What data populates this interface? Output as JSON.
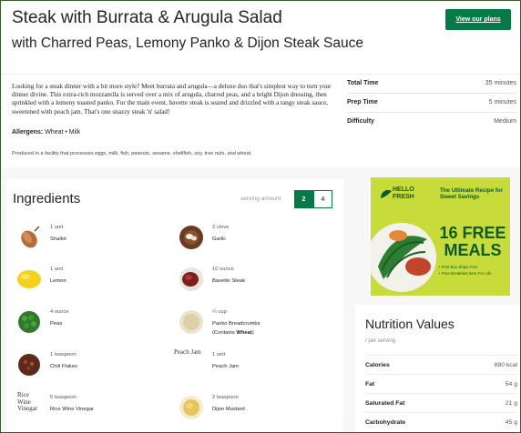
{
  "recipe": {
    "title": "Steak with Burrata & Arugula Salad",
    "subtitle": "with Charred Peas, Lemony Panko & Dijon Steak Sauce",
    "description": "Looking for a steak dinner with a bit more style? Meet burrata and arugula—a deluxe duo that's simplest way to turn your dinner divine. This extra-rich mozzarella is served over a mix of arugula, charred peas, and a bright Dijon dressing, then sprinkled with a lemony toasted panko. For the main event, bavette steak is seared and drizzled with a tangy steak sauce, sweetened with peach jam. That's one snazzy steak 'n' salad!",
    "allergens_label": "Allergens:",
    "allergens_value": "Wheat • Milk",
    "facility_note": "Produced in a facility that processes eggs, milk, fish, peanuts, sesame, shellfish, soy, tree nuts, and wheat."
  },
  "header": {
    "cta_label": "View our plans"
  },
  "meta": [
    {
      "label": "Total Time",
      "value": "35 minutes"
    },
    {
      "label": "Prep Time",
      "value": "5 minutes"
    },
    {
      "label": "Difficulty",
      "value": "Medium"
    }
  ],
  "ingredients": {
    "title": "Ingredients",
    "serving_label": "serving amount",
    "servings": [
      "2",
      "4"
    ],
    "selected_serving": "2",
    "items": [
      {
        "qty": "1 unit",
        "name": "Shallot",
        "icon": "shallot"
      },
      {
        "qty": "2 clove",
        "name": "Garlic",
        "icon": "garlic"
      },
      {
        "qty": "1 unit",
        "name": "Lemon",
        "icon": "lemon"
      },
      {
        "qty": "10 ounce",
        "name": "Bavette Steak",
        "icon": "steak"
      },
      {
        "qty": "4 ounce",
        "name": "Peas",
        "icon": "peas"
      },
      {
        "qty": "¼ cup",
        "name": "Panko Breadcrumbs",
        "name_extra_prefix": "(Contains ",
        "name_extra_bold": "Wheat",
        "name_extra_suffix": ")",
        "icon": "panko"
      },
      {
        "qty": "1 teaspoon",
        "name": "Chili Flakes",
        "icon": "chili-flakes"
      },
      {
        "qty": "1 unit",
        "name": "Peach Jam",
        "alt": "Peach Jam",
        "icon": "broken-image"
      },
      {
        "qty": "5 teaspoon",
        "name": "Rice Wine Vinegar",
        "alt": "Rice Wine Vinegar",
        "icon": "broken-image"
      },
      {
        "qty": "2 teaspoon",
        "name": "Dijon Mustard",
        "icon": "dijon"
      }
    ]
  },
  "ad": {
    "brand": "HELLO FRESH",
    "tagline": "The Ultimate Recipe for Sweet Savings",
    "headline": "16 FREE MEALS",
    "fine1": "+ First Box Ships Free",
    "fine2": "+ Free Breakfast Item For Life",
    "colors": {
      "background": "#c7dc3a",
      "text": "#0e5a25"
    }
  },
  "nutrition": {
    "title": "Nutrition Values",
    "subtitle": "/ per serving",
    "rows": [
      {
        "label": "Calories",
        "value": "880 kcal"
      },
      {
        "label": "Fat",
        "value": "54 g"
      },
      {
        "label": "Saturated Fat",
        "value": "21 g"
      },
      {
        "label": "Carbohydrate",
        "value": "45 g"
      }
    ]
  },
  "colors": {
    "accent": "#067a46",
    "page_background": "#f7f7f7"
  }
}
